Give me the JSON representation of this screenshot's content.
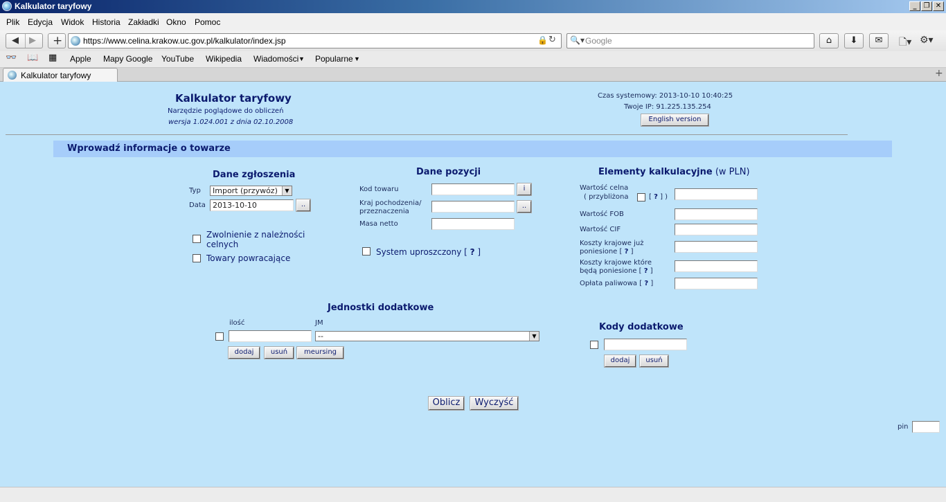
{
  "window": {
    "title": "Kalkulator taryfowy"
  },
  "menu": {
    "items": [
      "Plik",
      "Edycja",
      "Widok",
      "Historia",
      "Zakładki",
      "Okno",
      "Pomoc"
    ]
  },
  "nav": {
    "url": "https://www.celina.krakow.uc.gov.pl/kalkulator/index.jsp",
    "search_placeholder": "Google"
  },
  "bookmarks": {
    "items": [
      "Apple",
      "Mapy Google",
      "YouTube",
      "Wikipedia",
      "Wiadomości",
      "Popularne"
    ]
  },
  "tab": {
    "title": "Kalkulator taryfowy"
  },
  "header": {
    "title": "Kalkulator taryfowy",
    "subtitle": "Narzędzie poglądowe do obliczeń",
    "version": "wersja 1.024.001 z dnia 02.10.2008",
    "system_time": "Czas systemowy: 2013-10-10 10:40:25",
    "ip": "Twoje IP: 91.225.135.254",
    "english_button": "English version"
  },
  "section_title": "Wprowadź informacje o towarze",
  "dane_zgloszenia": {
    "heading": "Dane zgłoszenia",
    "typ_label": "Typ",
    "typ_value": "Import (przywóz)",
    "data_label": "Data",
    "data_value": "2013-10-10",
    "dots": "..",
    "zwolnienie": "Zwolnienie z należności celnych",
    "towary": "Towary powracające"
  },
  "dane_pozycji": {
    "heading": "Dane pozycji",
    "kod_label": "Kod towaru",
    "info_button": "i",
    "kraj_label_1": "Kraj pochodzenia/",
    "kraj_label_2": "przeznaczenia",
    "dots": "..",
    "masa_label": "Masa netto",
    "system": "System uproszczony [",
    "q": "?",
    "close": "]"
  },
  "elementy": {
    "heading": "Elementy kalkulacyjne",
    "heading_unit": "(w PLN)",
    "wartosc_celna_1": "Wartość celna",
    "wartosc_celna_2": "( przybliżona",
    "bracket_open": "[",
    "q": "?",
    "bracket_close": "] )",
    "fob": "Wartość FOB",
    "cif": "Wartość CIF",
    "koszty_juz_1": "Koszty krajowe już",
    "koszty_juz_2": "poniesione [",
    "koszty_ktore_1": "Koszty krajowe które",
    "koszty_ktore_2": "będą poniesione [",
    "oplata": "Opłata paliwowa [",
    "close": "]"
  },
  "jednostki": {
    "heading": "Jednostki dodatkowe",
    "ilosc_label": "ilość",
    "jm_label": "JM",
    "jm_value": "--",
    "dodaj": "dodaj",
    "usun": "usuń",
    "meursing": "meursing"
  },
  "kody": {
    "heading": "Kody dodatkowe",
    "dodaj": "dodaj",
    "usun": "usuń"
  },
  "actions": {
    "oblicz": "Oblicz",
    "wyczysc": "Wyczyść"
  },
  "pin": {
    "label": "pin"
  }
}
